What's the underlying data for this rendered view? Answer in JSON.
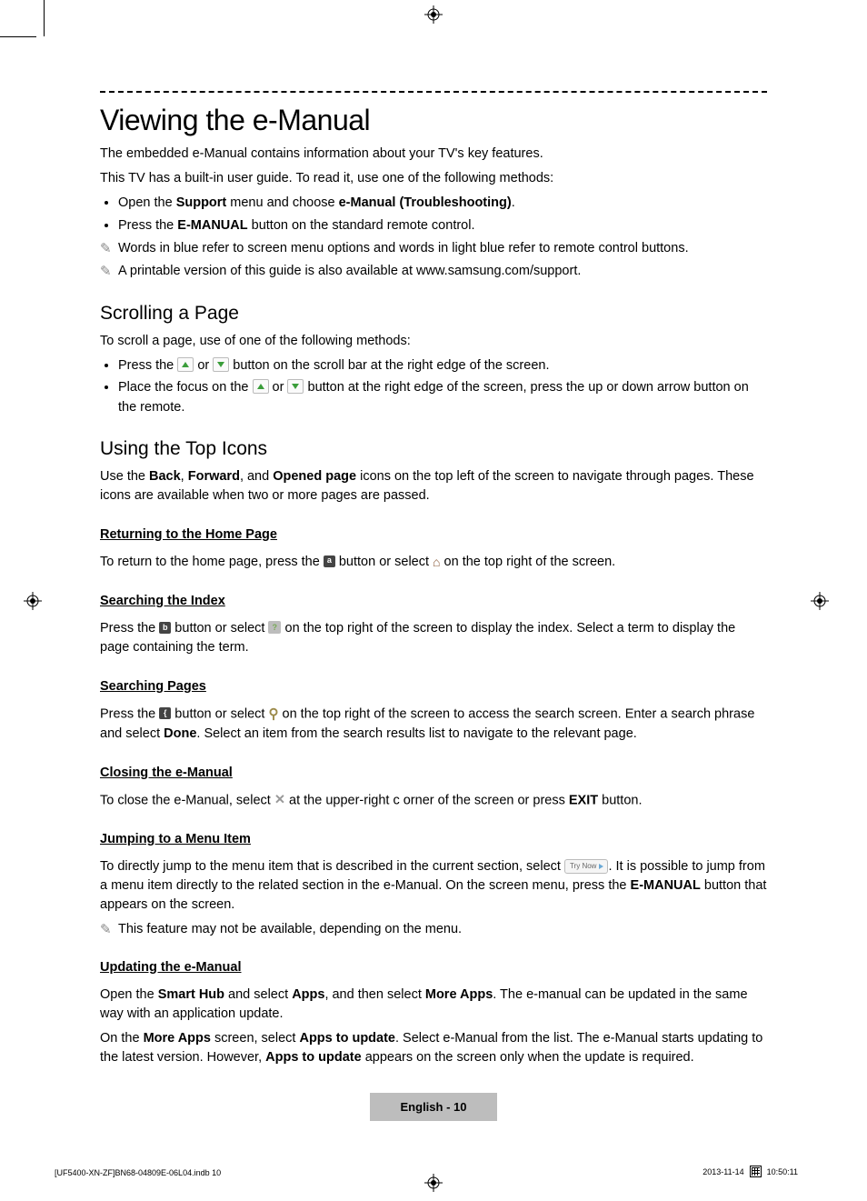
{
  "title": "Viewing the e-Manual",
  "intro": [
    "The embedded e-Manual contains information about your TV's key features.",
    "This TV has a built-in user guide. To read it, use one of the following methods:"
  ],
  "open_bullets": {
    "b1_pre": "Open the ",
    "b1_bold1": "Support",
    "b1_mid": " menu and choose ",
    "b1_bold2": "e-Manual (Troubleshooting)",
    "b1_post": ".",
    "b2_pre": "Press the ",
    "b2_bold": "E-MANUAL",
    "b2_post": " button on the standard remote control."
  },
  "notes_top": [
    "Words in blue refer to screen menu options and words in light blue refer to remote control buttons.",
    "A printable version of this guide is also available at www.samsung.com/support."
  ],
  "scroll": {
    "heading": "Scrolling a Page",
    "intro": "To scroll a page, use of one of the following methods:",
    "b1_pre": "Press the ",
    "b1_mid": " or ",
    "b1_post": " button on the scroll bar at the right edge of the screen.",
    "b2_pre": "Place the focus on the ",
    "b2_mid": " or ",
    "b2_post": " button at the right edge of the screen, press the up or down arrow button on the remote."
  },
  "topicons": {
    "heading": "Using the Top Icons",
    "intro_pre": "Use the ",
    "intro_b1": "Back",
    "intro_c1": ", ",
    "intro_b2": "Forward",
    "intro_c2": ", and ",
    "intro_b3": "Opened page",
    "intro_post": " icons on the top left of the screen to navigate through pages. These icons are available when two or more pages are passed."
  },
  "home": {
    "heading": "Returning to the Home Page",
    "pre": "To return to the home page, press the ",
    "badge": "a",
    "mid": " button or select ",
    "post": " on the top right of the screen."
  },
  "index": {
    "heading": "Searching the Index",
    "pre": "Press the ",
    "badge": "b",
    "mid": " button or select ",
    "post": " on the top right of the screen to display the index. Select a term to display the page containing the term."
  },
  "searchp": {
    "heading": "Searching Pages",
    "pre": "Press the ",
    "badge": "{",
    "mid": " button or select ",
    "post": " on the top right of the screen to access the search screen. Enter a search phrase and select ",
    "done": "Done",
    "tail": ". Select an item from the search results list to navigate to the relevant page."
  },
  "closing": {
    "heading": "Closing the e-Manual",
    "pre": "To close the e-Manual, select ",
    "mid": " at the upper-right c orner of the screen or press ",
    "exit": "EXIT",
    "post": " button."
  },
  "jumping": {
    "heading": "Jumping to a Menu Item",
    "pre": "To directly jump to the menu item that is described in the current section, select ",
    "trynow": "Try Now",
    "post1": ". It is possible to jump from a menu item directly to the related section in the e-Manual. On the screen menu, press the ",
    "emanual": "E-MANUAL",
    "post2": " button that appears on the screen.",
    "note": "This feature may not be available, depending on the menu."
  },
  "updating": {
    "heading": "Updating the e-Manual",
    "p1_pre": "Open the ",
    "p1_b1": "Smart Hub",
    "p1_mid1": " and select ",
    "p1_b2": "Apps",
    "p1_mid2": ", and then select ",
    "p1_b3": "More Apps",
    "p1_post": ". The e-manual can be updated in the same way with an application update.",
    "p2_pre": "On the ",
    "p2_b1": "More Apps",
    "p2_mid1": " screen, select ",
    "p2_b2": "Apps to update",
    "p2_mid2": ". Select e-Manual from the list. The e-Manual starts updating to the latest version. However, ",
    "p2_b3": "Apps to update",
    "p2_post": " appears on the screen only when the update is required."
  },
  "footer": "English - 10",
  "print_left": "[UF5400-XN-ZF]BN68-04809E-06L04.indb   10",
  "print_right_date": "2013-11-14",
  "print_right_time": "10:50:11"
}
